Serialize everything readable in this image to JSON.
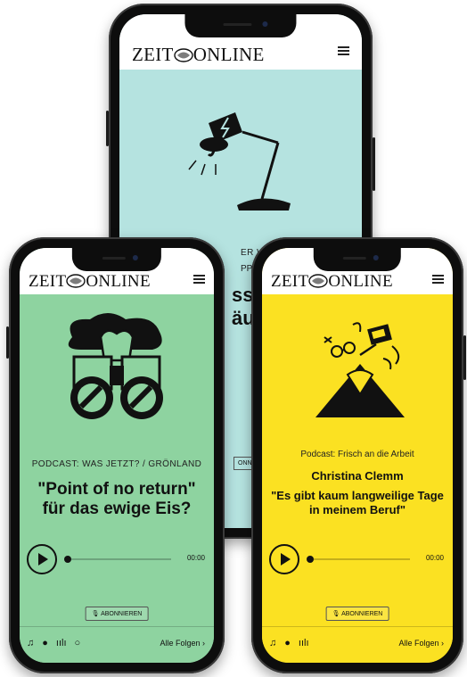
{
  "brand": {
    "name": "ZEIT ONLINE",
    "word_left": "ZEIT",
    "word_right": "ONLINE"
  },
  "phones": {
    "back": {
      "bg_color": "#b5e3e0",
      "partial_text_1": "ER WEI",
      "partial_text_2": "PPHO",
      "partial_headline": "sse",
      "partial_headline_2": "äus",
      "partial_button": "ONNIE"
    },
    "left": {
      "bg_color": "#8ed3a0",
      "overline": "PODCAST: WAS JETZT? / GRÖNLAND",
      "headline": "\"Point of no return\" für das ewige Eis?",
      "time": "00:00",
      "subscribe": "ABONNIEREN",
      "all_episodes": "Alle Folgen ›",
      "footer_icons": [
        "music-icon",
        "spotify-icon",
        "podcast-bars-icon",
        "circle-icon"
      ]
    },
    "right": {
      "bg_color": "#fbe122",
      "overline": "Podcast: Frisch an die Arbeit",
      "guest": "Christina Clemm",
      "headline": "\"Es gibt kaum langweilige Tage in meinem Beruf\"",
      "time": "00:00",
      "subscribe": "ABONNIEREN",
      "all_episodes": "Alle Folgen ›",
      "footer_icons": [
        "music-icon",
        "spotify-icon",
        "podcast-bars-icon"
      ]
    }
  }
}
